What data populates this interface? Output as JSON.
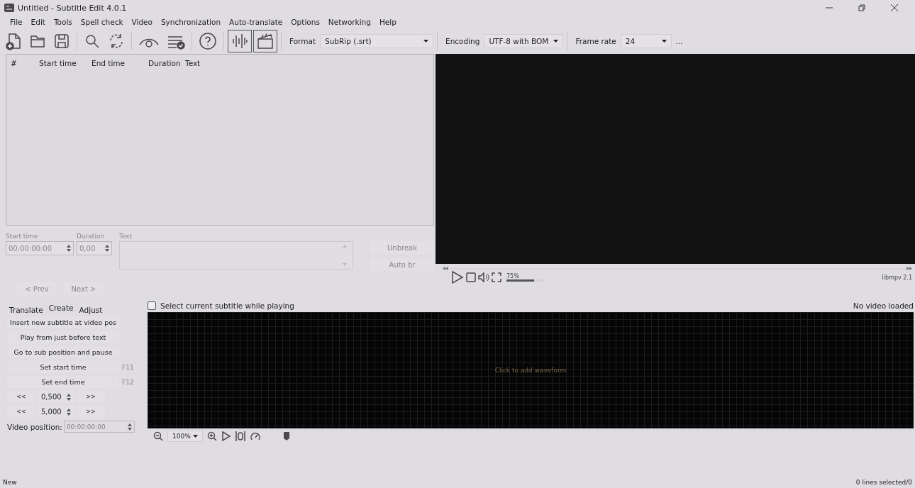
{
  "window": {
    "title": "Untitled - Subtitle Edit 4.0.1"
  },
  "menu": [
    "File",
    "Edit",
    "Tools",
    "Spell check",
    "Video",
    "Synchronization",
    "Auto-translate",
    "Options",
    "Networking",
    "Help"
  ],
  "toolbar": {
    "buttons": [
      {
        "kind": "new",
        "on": false
      },
      {
        "kind": "open",
        "on": false
      },
      {
        "kind": "save",
        "on": false
      },
      {
        "kind": "find",
        "on": false
      },
      {
        "kind": "replace",
        "on": false
      },
      {
        "kind": "visual-sync",
        "on": false
      },
      {
        "kind": "spell-check",
        "on": false
      },
      {
        "kind": "help",
        "on": false
      },
      {
        "kind": "waveform",
        "on": true
      },
      {
        "kind": "video",
        "on": true
      }
    ],
    "format": {
      "label": "Format",
      "value": "SubRip (.srt)"
    },
    "encoding": {
      "label": "Encoding",
      "value": "UTF-8 with BOM"
    },
    "frame_rate": {
      "label": "Frame rate",
      "value": "24"
    },
    "more": "..."
  },
  "subtitle_table": {
    "columns": [
      "#",
      "Start time",
      "End time",
      "Duration",
      "Text"
    ]
  },
  "editor": {
    "start_time": {
      "label": "Start time",
      "value": "00:00:00:00",
      "disabled": true
    },
    "duration": {
      "label": "Duration",
      "value": "0,00",
      "disabled": true
    },
    "text": {
      "label": "Text",
      "disabled": true
    },
    "side_buttons": [
      {
        "label": "Unbreak",
        "disabled": true
      },
      {
        "label": "Auto br",
        "disabled": true
      }
    ],
    "nav_buttons": [
      {
        "label": "< Prev",
        "disabled": true
      },
      {
        "label": "Next >",
        "disabled": true
      }
    ]
  },
  "video_player": {
    "volume": {
      "reading": "75%",
      "level": 0.75
    },
    "engine": "libmpv 2.1"
  },
  "tabs": [
    {
      "label": "Translate",
      "selected": false
    },
    {
      "label": "Create",
      "selected": true
    },
    {
      "label": "Adjust",
      "selected": false
    }
  ],
  "create_panel": {
    "buttons": [
      {
        "label": "Insert new subtitle at video pos"
      },
      {
        "label": "Play from just before text"
      },
      {
        "label": "Go to sub position and pause"
      },
      {
        "label": "Set start time",
        "shortcut": "F11"
      },
      {
        "label": "Set end time",
        "shortcut": "F12"
      }
    ],
    "steppers": [
      {
        "back": "<<",
        "value": "0,500",
        "forward": ">>"
      },
      {
        "back": "<<",
        "value": "5,000",
        "forward": ">>"
      }
    ],
    "video_position": {
      "label": "Video position:",
      "value": "00:00:00:00",
      "disabled": true
    }
  },
  "waveform": {
    "select_current": {
      "label": "Select current subtitle while playing",
      "checked": false
    },
    "status": "No video loaded",
    "hint": "Click to add waveform",
    "zoom": "100%"
  },
  "status_bar": {
    "left": "New",
    "right": "0 lines selected/0"
  }
}
